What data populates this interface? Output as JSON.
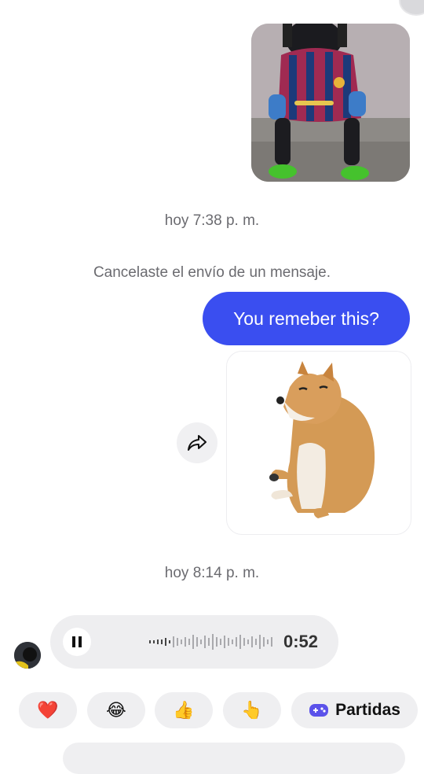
{
  "thread": {
    "photo_message": {
      "description_icon": "photo-message"
    },
    "timestamp_1": "hoy 7:38 p. m.",
    "unsent_notice": "Cancelaste el envío de un mensaje.",
    "outgoing_text": "You remeber this?",
    "sticker_message": {
      "icon": "doge-sticker"
    },
    "timestamp_2": "hoy 8:14 p. m.",
    "voice_message": {
      "duration": "0:52",
      "state": "playing"
    }
  },
  "quick_replies": {
    "items": [
      {
        "emoji": "❤️",
        "name": "heart"
      },
      {
        "emoji": "😂",
        "name": "laughing"
      },
      {
        "emoji": "👍",
        "name": "thumbs-up"
      },
      {
        "emoji": "👆",
        "name": "pointing-up"
      }
    ],
    "games_label": "Partidas"
  },
  "colors": {
    "outgoing_bubble": "#3a4ef0",
    "games_icon": "#5b52ea"
  }
}
